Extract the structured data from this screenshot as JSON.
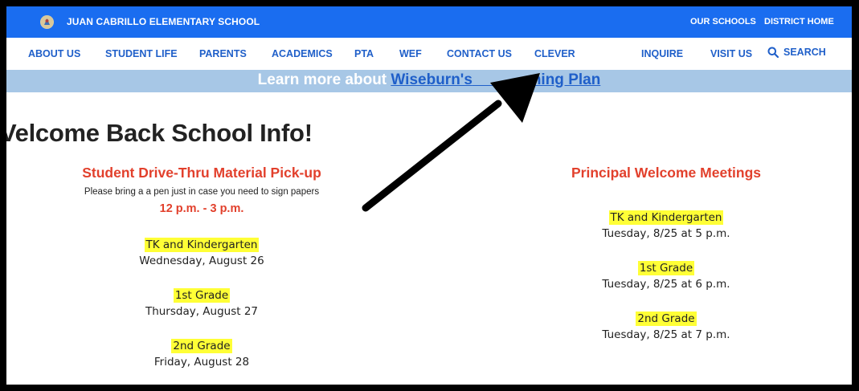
{
  "header": {
    "school_name": "JUAN CABRILLO ELEMENTARY SCHOOL",
    "links": [
      "OUR SCHOOLS",
      "DISTRICT HOME"
    ]
  },
  "nav": {
    "items": [
      "ABOUT US",
      "STUDENT LIFE",
      "PARENTS",
      "ACADEMICS",
      "PTA",
      "WEF",
      "CONTACT US",
      "CLEVER",
      "INQUIRE",
      "VISIT US"
    ],
    "search_label": "SEARCH"
  },
  "banner": {
    "prefix": "Learn more about ",
    "link_part1": "Wiseburn's",
    "link_part2": "ening Plan"
  },
  "page": {
    "title": "Velcome Back School Info!"
  },
  "pickup": {
    "title": "Student Drive-Thru Material Pick-up",
    "note": "Please bring a a pen just in case you need to sign papers",
    "time": "12 p.m. - 3 p.m.",
    "groups": [
      {
        "grade": "TK and Kindergarten",
        "date": "Wednesday, August 26"
      },
      {
        "grade": "1st Grade",
        "date": "Thursday, August 27"
      },
      {
        "grade": "2nd Grade",
        "date": "Friday, August 28"
      }
    ]
  },
  "meetings": {
    "title": "Principal Welcome Meetings",
    "groups": [
      {
        "grade": "TK and Kindergarten",
        "date": "Tuesday, 8/25 at 5 p.m."
      },
      {
        "grade": "1st Grade",
        "date": "Tuesday, 8/25 at 6 p.m."
      },
      {
        "grade": "2nd Grade",
        "date": "Tuesday, 8/25 at 7 p.m."
      }
    ]
  },
  "colors": {
    "topbar": "#1a6df0",
    "nav_text": "#1f5fc9",
    "banner": "#a7c7e6",
    "accent_red": "#e2402c",
    "highlight": "#ffff36"
  },
  "icons": [
    "school-logo-icon",
    "search-icon",
    "annotation-arrow-icon"
  ]
}
